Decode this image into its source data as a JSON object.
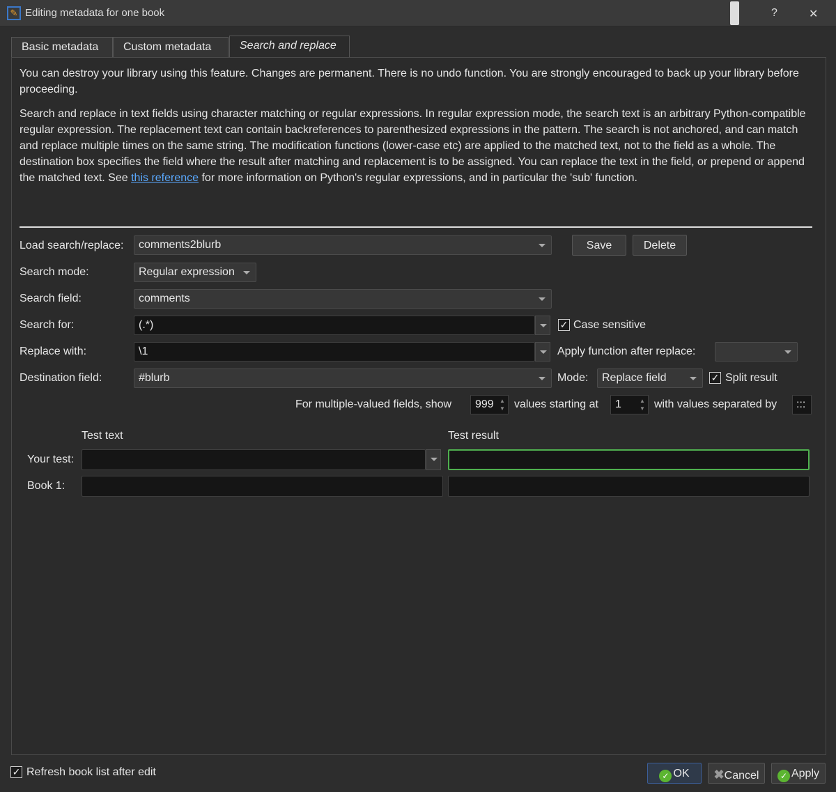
{
  "window": {
    "title": "Editing metadata for one book",
    "help": "?",
    "close": "✕"
  },
  "tabs": [
    {
      "label": "Basic metadata"
    },
    {
      "label": "Custom metadata"
    },
    {
      "label": "Search and replace"
    }
  ],
  "warning": "You can destroy your library using this feature. Changes are permanent. There is no undo function. You are strongly encouraged to back up your library before proceeding.",
  "description": {
    "before": "Search and replace in text fields using character matching or regular expressions. In regular expression mode, the search text is an arbitrary Python-compatible regular expression. The replacement text can contain backreferences to parenthesized expressions in the pattern. The search is not anchored, and can match and replace multiple times on the same string. The modification functions (lower-case etc) are applied to the matched text, not to the field as a whole. The destination box specifies the field where the result after matching and replacement is to be assigned. You can replace the text in the field, or prepend or append the matched text. See ",
    "link": "this reference",
    "after": " for more information on Python's regular expressions, and in particular the 'sub' function."
  },
  "form": {
    "load_label": "Load search/replace:",
    "load_value": "comments2blurb",
    "save": "Save",
    "delete": "Delete",
    "mode_label": "Search mode:",
    "mode_value": "Regular expression",
    "field_label": "Search field:",
    "field_value": "comments",
    "search_label": "Search for:",
    "search_value": "(.*)",
    "case_sensitive": "Case sensitive",
    "case_checked": true,
    "replace_label": "Replace with:",
    "replace_value": "\\1",
    "apply_fn_label": "Apply function after replace:",
    "apply_fn_value": "",
    "dest_label": "Destination field:",
    "dest_value": "#blurb",
    "dmode_label": "Mode:",
    "dmode_value": "Replace field",
    "split_result": "Split result",
    "split_checked": true,
    "multi_show_label": "For multiple-valued fields, show",
    "multi_show_value": "999",
    "starting_label": "values starting at",
    "starting_value": "1",
    "separated_label": "with values separated by",
    "separator_value": ":::"
  },
  "test": {
    "test_text_header": "Test text",
    "test_result_header": "Test result",
    "your_test_label": "Your test:",
    "book1_label": "Book 1:"
  },
  "footer": {
    "refresh": "Refresh book list after edit",
    "refresh_checked": true,
    "ok": "OK",
    "cancel": "Cancel",
    "apply": "Apply"
  }
}
